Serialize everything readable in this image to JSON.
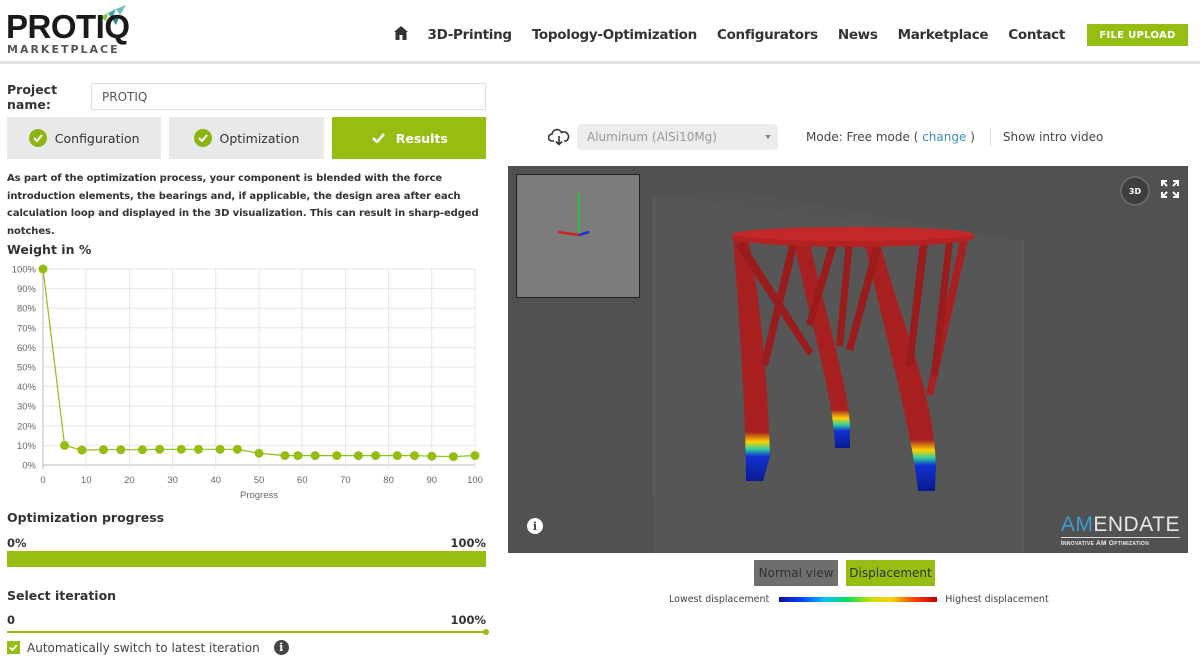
{
  "header": {
    "logo_main": "PROTIQ",
    "logo_sub": "MARKETPLACE",
    "nav": [
      "3D-Printing",
      "Topology-Optimization",
      "Configurators",
      "News",
      "Marketplace",
      "Contact"
    ],
    "upload_label": "FILE UPLOAD"
  },
  "project": {
    "label": "Project name:",
    "value": "PROTIQ"
  },
  "steps": [
    {
      "label": "Configuration",
      "state": "done"
    },
    {
      "label": "Optimization",
      "state": "done"
    },
    {
      "label": "Results",
      "state": "active"
    }
  ],
  "description": "As part of the optimization process, your component is blended with the force introduction elements, the bearings and, if applicable, the design area after each calculation loop and displayed in the 3D visualization. This can result in sharp-edged notches.",
  "chart_data": {
    "type": "line",
    "title": "Weight in %",
    "xlabel": "Progress",
    "ylabel": "",
    "xlim": [
      0,
      100
    ],
    "ylim": [
      0,
      100
    ],
    "x_ticks": [
      0,
      10,
      20,
      30,
      40,
      50,
      60,
      70,
      80,
      90,
      100
    ],
    "y_ticks": [
      "0%",
      "10%",
      "20%",
      "30%",
      "40%",
      "50%",
      "60%",
      "70%",
      "80%",
      "90%",
      "100%"
    ],
    "grid": true,
    "series": [
      {
        "name": "Weight",
        "color": "#95bd12",
        "x": [
          0,
          5,
          9,
          14,
          18,
          23,
          27,
          32,
          36,
          41,
          45,
          50,
          56,
          59,
          63,
          68,
          73,
          77,
          82,
          86,
          90,
          95,
          100
        ],
        "values": [
          100,
          10,
          7.6,
          7.8,
          7.8,
          7.8,
          8,
          8,
          8,
          8,
          8,
          6,
          4.8,
          4.8,
          4.8,
          4.8,
          4.8,
          4.8,
          4.8,
          4.8,
          4.5,
          4.3,
          4.8
        ]
      }
    ]
  },
  "optimization_progress": {
    "title": "Optimization progress",
    "min_label": "0%",
    "max_label": "100%",
    "value": 1.0
  },
  "iteration": {
    "title": "Select iteration",
    "min_label": "0",
    "max_label": "100%",
    "value": 1.0,
    "auto_switch_label": "Automatically switch to latest iteration",
    "auto_switch_checked": true
  },
  "toolbar": {
    "material": "Aluminum (AlSi10Mg)",
    "mode_prefix": "Mode: Free mode (",
    "mode_link": "change",
    "mode_suffix": ")",
    "intro_video": "Show intro video"
  },
  "viewer": {
    "btn_3d": "3D",
    "brand_am": "AM",
    "brand_rest": "ENDATE",
    "brand_sub": "Innovative AM Optimization"
  },
  "view_buttons": {
    "normal": "Normal view",
    "displacement": "Displacement"
  },
  "legend": {
    "low": "Lowest displacement",
    "high": "Highest displacement"
  },
  "colors": {
    "accent": "#95bd12",
    "link": "#3a8fb7",
    "viewer_bg": "#515151",
    "model": "#b52020"
  }
}
